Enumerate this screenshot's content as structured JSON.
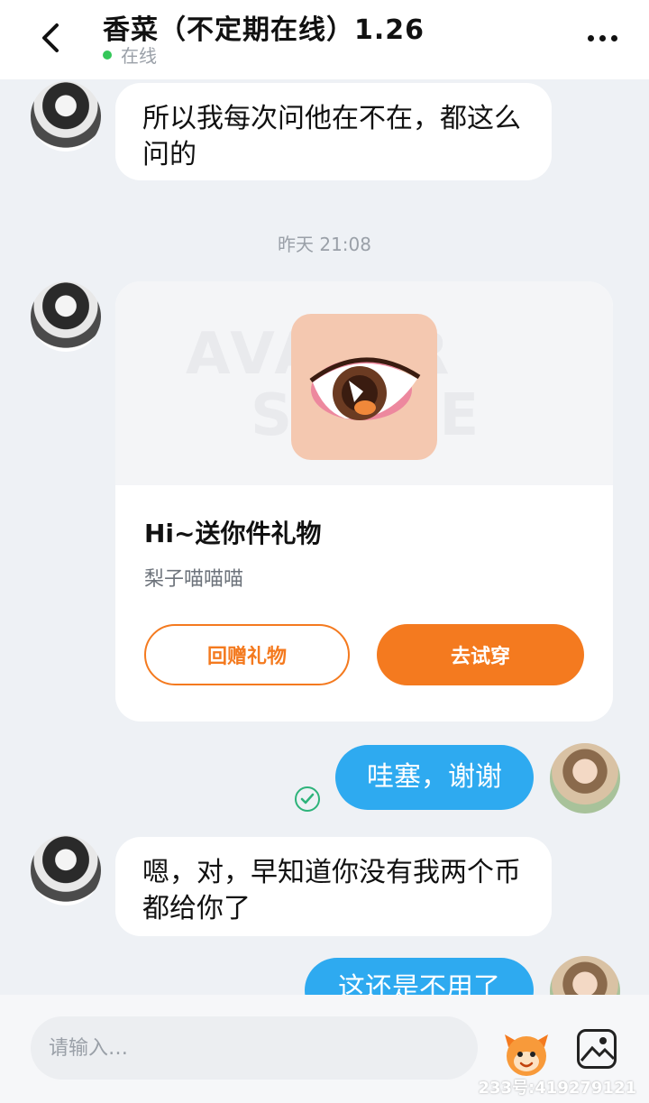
{
  "header": {
    "title": "香菜（不定期在线）1.26",
    "status": "在线"
  },
  "messages": {
    "peer_1": "所以我每次问他在不在，都这么问的",
    "time_divider": "昨天 21:08",
    "gift": {
      "watermark_1": "AVATAR",
      "watermark_2": "STORE",
      "title": "Hi~送你件礼物",
      "sender": "梨子喵喵喵",
      "return_gift_label": "回赠礼物",
      "try_on_label": "去试穿"
    },
    "self_1": "哇塞，谢谢",
    "peer_2": "嗯，对，早知道你没有我两个币都给你了",
    "self_2": "这还是不用了"
  },
  "input": {
    "placeholder": "请输入…"
  },
  "watermark": {
    "corner_text": "233号:419279121"
  },
  "colors": {
    "accent_orange": "#f47a1f",
    "self_bubble_blue": "#2eaaf0",
    "online_green": "#34c759"
  },
  "icons": {
    "back": "back-arrow-icon",
    "more": "more-dots-icon",
    "read": "check-circle-icon",
    "emoji": "mascot-emoji-icon",
    "image": "image-icon"
  }
}
